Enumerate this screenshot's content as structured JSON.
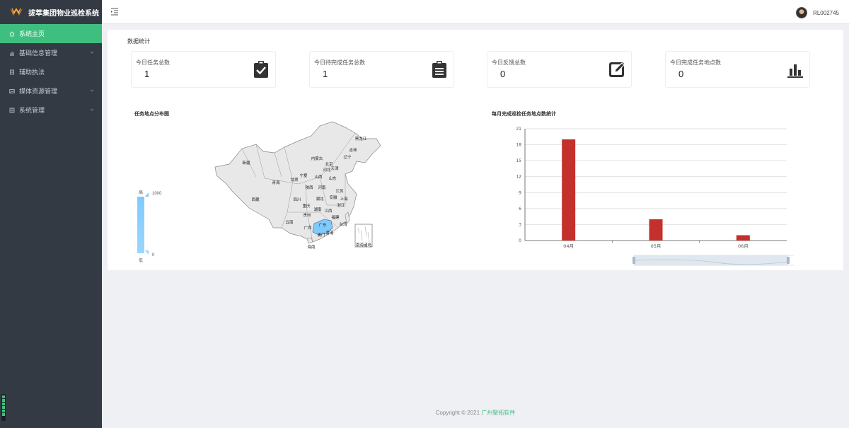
{
  "app": {
    "title": "拔萃集团物业巡检系统"
  },
  "sidebar": {
    "items": [
      {
        "label": "系统主页",
        "icon": "home-icon",
        "active": true
      },
      {
        "label": "基础信息管理",
        "icon": "bar-chart-icon"
      },
      {
        "label": "辅助执法",
        "icon": "document-icon"
      },
      {
        "label": "媒体资源管理",
        "icon": "image-icon"
      },
      {
        "label": "系统管理",
        "icon": "grid-icon"
      }
    ]
  },
  "topbar": {
    "username": "RL002745"
  },
  "main": {
    "section_title": "数据统计",
    "stats": [
      {
        "label": "今日任务总数",
        "value": "1",
        "icon": "clipboard-check-icon"
      },
      {
        "label": "今日待完成任务总数",
        "value": "1",
        "icon": "clipboard-list-icon"
      },
      {
        "label": "今日反馈总数",
        "value": "0",
        "icon": "edit-icon"
      },
      {
        "label": "今日完成任务地点数",
        "value": "0",
        "icon": "bar-chart-icon"
      }
    ],
    "map": {
      "title": "任务地点分布图",
      "legend_high": "高",
      "legend_low": "低",
      "legend_max": "1000",
      "legend_min": "0",
      "regions": [
        "黑龙江",
        "吉林",
        "辽宁",
        "内蒙古",
        "北京",
        "天津",
        "河北",
        "山西",
        "山东",
        "新疆",
        "青海",
        "甘肃",
        "宁夏",
        "陕西",
        "河南",
        "江苏",
        "安徽",
        "上海",
        "西藏",
        "四川",
        "湖北",
        "重庆",
        "浙江",
        "湖南",
        "江西",
        "贵州",
        "福建",
        "云南",
        "广西",
        "广东",
        "台湾",
        "海南",
        "香港",
        "澳门",
        "南海诸岛"
      ],
      "highlighted_region": "广东",
      "highlight_color": "#7ecbff"
    },
    "bar_chart": {
      "title": "每月完成巡检任务地点数统计"
    }
  },
  "chart_data": {
    "type": "bar",
    "title": "每月完成巡检任务地点数统计",
    "categories": [
      "04月",
      "05月",
      "06月"
    ],
    "values": [
      19,
      4,
      1
    ],
    "ylim": [
      0,
      21
    ],
    "yticks": [
      0,
      3,
      6,
      9,
      12,
      15,
      18,
      21
    ],
    "bar_color": "#c4302b",
    "grid": true
  },
  "footer": {
    "text": "Copyright © 2021",
    "brand": "广州聚拓软件"
  },
  "colors": {
    "accent": "#3fbf7f",
    "sidebar": "#343a43"
  }
}
